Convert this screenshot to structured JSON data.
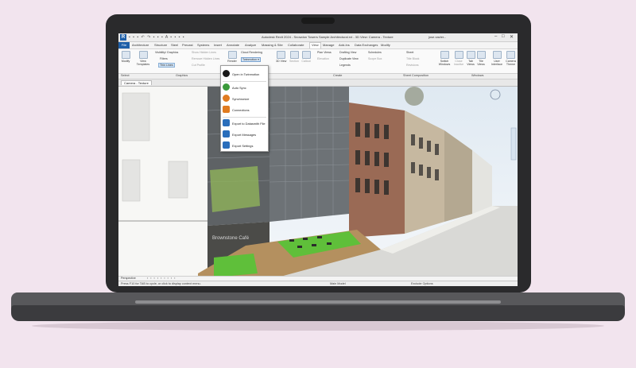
{
  "window": {
    "app_title": "Autodesk Revit 2024 - Snowdon Towers Sample Architectural.rvt - 3D View: Camera - Texture",
    "user": "jose.xavier...",
    "quick_access_glyphs": "▪ ▪ ▪ ↶ ↷ ▪ ▪ ▪ A ▪ ▪ ▪ ▪"
  },
  "tabs": [
    "File",
    "Architecture",
    "Structure",
    "Steel",
    "Precast",
    "Systems",
    "Insert",
    "Annotate",
    "Analyze",
    "Massing & Site",
    "Collaborate",
    "View",
    "Manage",
    "Add-Ins",
    "Data Exchanges",
    "Modify"
  ],
  "active_tab": "View",
  "ribbon": {
    "modify": "Modify",
    "view_templates": "View Templates",
    "visibility_graphics": "Visibility/ Graphics",
    "filters": "Filters",
    "thin_lines": "Thin Lines",
    "show_hidden_lines": "Show Hidden Lines",
    "remove_hidden_lines": "Remove Hidden Lines",
    "cut_profile": "Cut Profile",
    "render": "Render",
    "cloud_rendering": "Cloud Rendering",
    "twinmotion": "Twinmotion",
    "view_3d": "3D View",
    "section": "Section",
    "callout": "Callout",
    "plan_views": "Plan Views",
    "elevation": "Elevation",
    "drafting_view": "Drafting View",
    "duplicate_view": "Duplicate View",
    "legends": "Legends",
    "schedules": "Schedules",
    "scope_box": "Scope Box",
    "sheet": "Sheet",
    "title_block": "Title Block",
    "revisions": "Revisions",
    "switch_windows": "Switch Windows",
    "close_inactive": "Close Inactive",
    "tab_views": "Tab Views",
    "tile_views": "Tile Views",
    "user_interface": "User Interface",
    "camera_theme": "Camera Theme",
    "panel_select": "Select",
    "panel_graphics": "Graphics",
    "panel_create": "Create",
    "panel_sheet_composition": "Sheet Composition",
    "panel_windows": "Windows"
  },
  "twinmotion_menu": [
    {
      "label": "Open in Twinmotion",
      "icon": "twinmotion-icon",
      "color": "#1a1a1a"
    },
    {
      "label": "Auto Sync",
      "icon": "auto-sync-icon",
      "color": "#3a9a3a"
    },
    {
      "label": "Synchronize",
      "icon": "synchronize-icon",
      "color": "#e07b20"
    },
    {
      "label": "Connections",
      "icon": "connections-icon",
      "color": "#e07b20"
    },
    {
      "label": "Export to Datasmith File",
      "icon": "export-datasmith-icon",
      "color": "#2a6ebb"
    },
    {
      "label": "Export Messages",
      "icon": "export-messages-icon",
      "color": "#2a6ebb"
    },
    {
      "label": "Export Settings",
      "icon": "export-settings-icon",
      "color": "#2a6ebb"
    }
  ],
  "view_tab": "Camera - Texture",
  "scene": {
    "storefront_sign": "Brownstone Café"
  },
  "view_control_bar": {
    "projection": "Perspective"
  },
  "status_bar": {
    "hint": "Press F10 for TAB to cycle, or click to display context menu.",
    "model": "Main Model",
    "exclude_options": "Exclude Options"
  },
  "colors": {
    "revit_blue": "#1f5fa8",
    "laptop_body": "#2a2a2c",
    "background": "#f2e4ee"
  }
}
